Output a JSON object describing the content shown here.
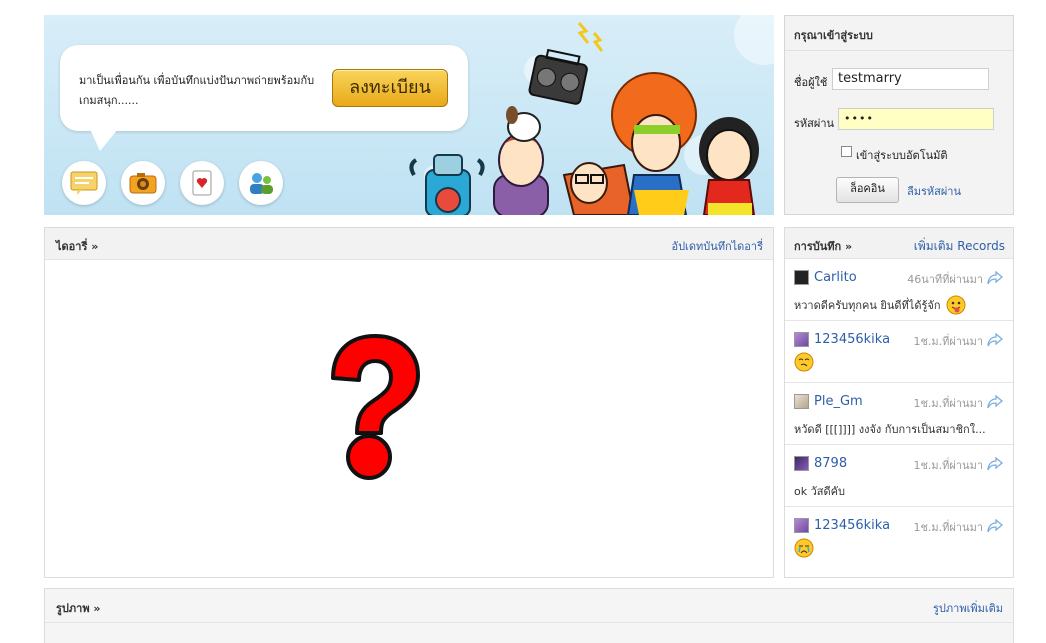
{
  "banner": {
    "bubble_text": "มาเป็นเพื่อนกัน เพื่อบันทึกแบ่งปันภาพถ่ายพร้อมกับเกมสนุก......",
    "register_label": "ลงทะเบียน",
    "icons": [
      "chat-icon",
      "camera-icon",
      "card-icon",
      "people-icon"
    ]
  },
  "login": {
    "title": "กรุณาเข้าสู่ระบบ",
    "username_label": "ชื่อผู้ใช้",
    "username_value": "testmarry",
    "password_label": "รหัสผ่าน",
    "password_value": "••••",
    "remember_label": "เข้าสู่ระบบอัตโนมัติ",
    "login_button": "ล็อคอิน",
    "forgot_link": "ลืมรหัสผ่าน"
  },
  "diary": {
    "title": "ไดอารี่ »",
    "link": "อัปเดทบันทึกไดอารี่"
  },
  "records": {
    "title": "การบันทึก »",
    "more_link": "เพิ่มเติม Records",
    "items": [
      {
        "user": "Carlito",
        "time": "46นาทีที่ผ่านมา",
        "message": "หวาดดีครับทุกคน ยินดีที่ได้รู้จัก",
        "emoticon": "tongue-emoticon"
      },
      {
        "user": "123456kika",
        "time": "1ช.ม.ที่ผ่านมา",
        "message": "",
        "emoticon": "dizzy-emoticon"
      },
      {
        "user": "Ple_Gm",
        "time": "1ช.ม.ที่ผ่านมา",
        "message": "หวัดดี [[[]]]] งงจัง กับการเป็นสมาชิกใ...",
        "emoticon": ""
      },
      {
        "user": "8798",
        "time": "1ช.ม.ที่ผ่านมา",
        "message": "ok วัสดีคับ",
        "emoticon": ""
      },
      {
        "user": "123456kika",
        "time": "1ช.ม.ที่ผ่านมา",
        "message": "",
        "emoticon": "crying-emoticon"
      }
    ]
  },
  "photos": {
    "title": "รูปภาพ »",
    "more_link": "รูปภาพเพิ่มเติม"
  }
}
